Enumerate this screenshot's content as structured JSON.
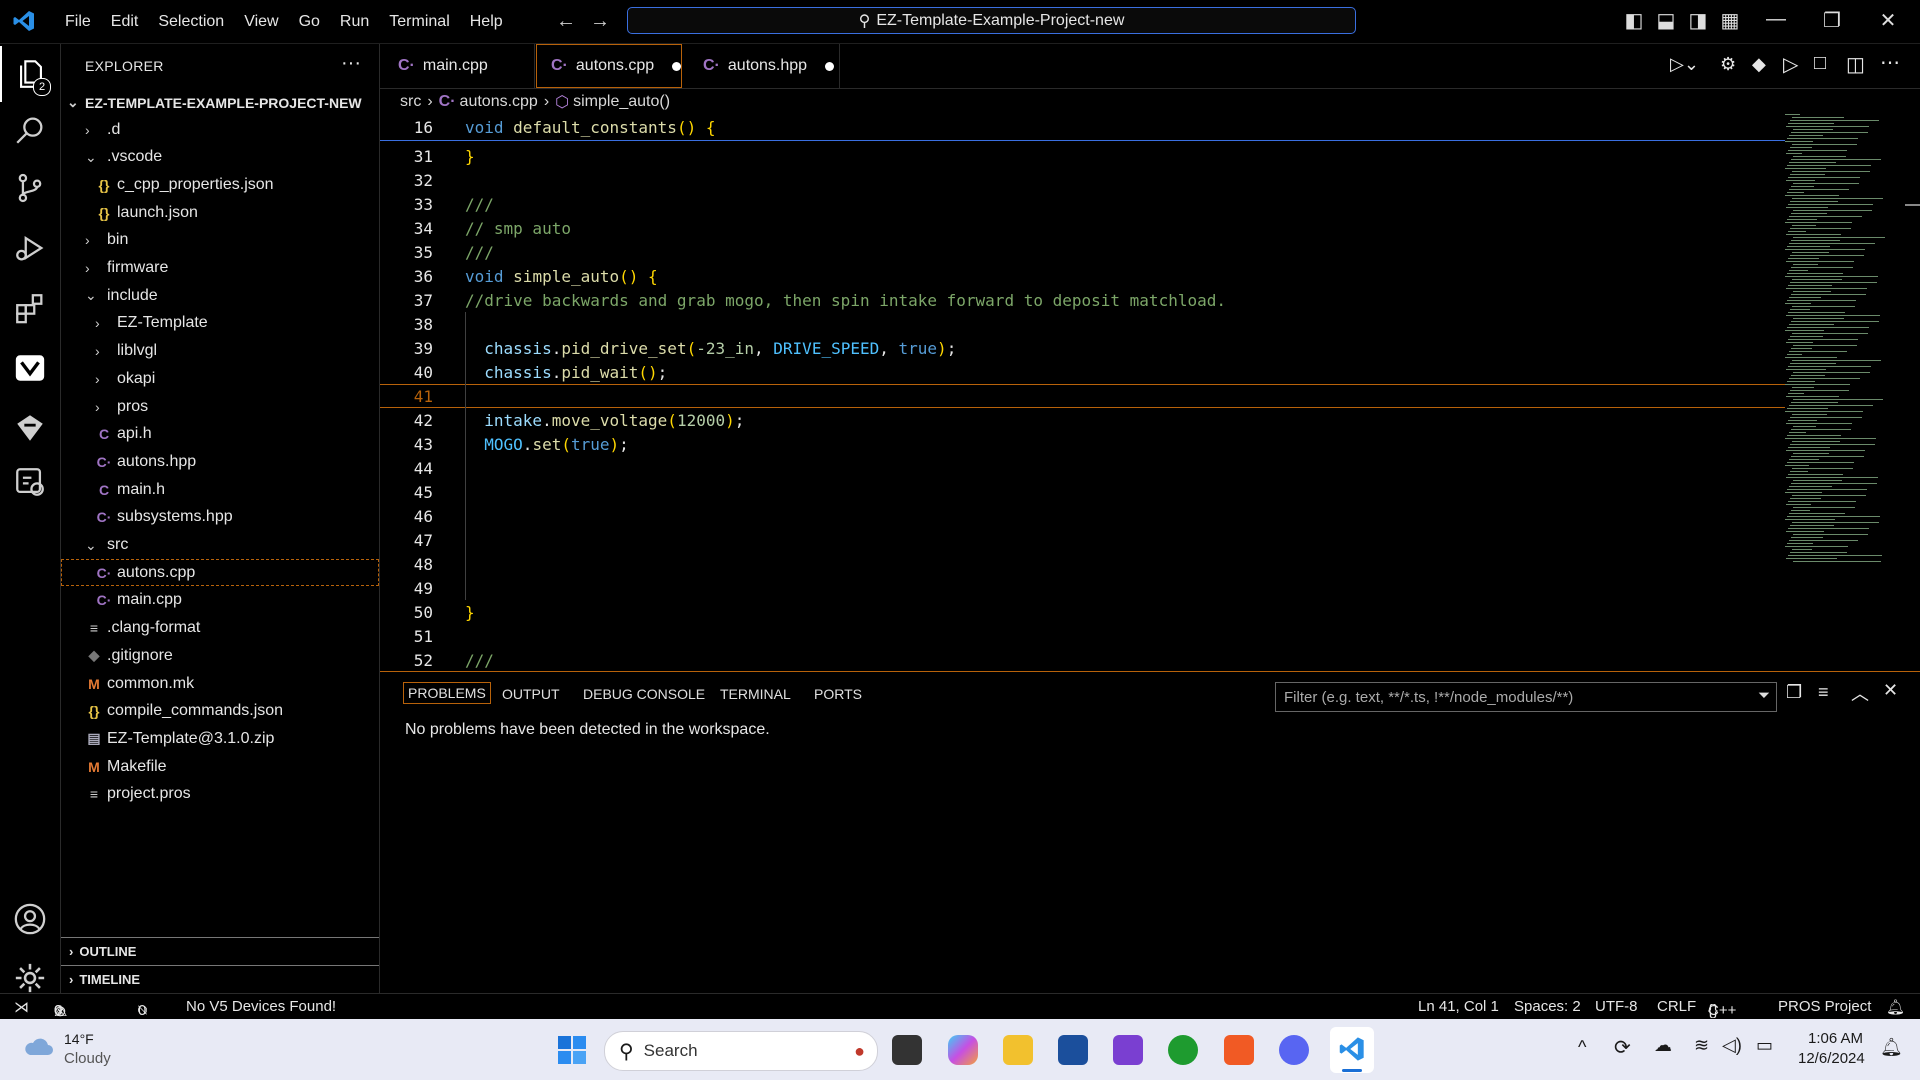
{
  "titlebar": {
    "menu": [
      "File",
      "Edit",
      "Selection",
      "View",
      "Go",
      "Run",
      "Terminal",
      "Help"
    ],
    "command_center": "EZ-Template-Example-Project-new"
  },
  "activity": {
    "explorer_badge": "2"
  },
  "sidebar": {
    "header": "EXPLORER",
    "more": "···",
    "root": "EZ-TEMPLATE-EXAMPLE-PROJECT-NEW",
    "items": [
      {
        "label": ".d"
      },
      {
        "label": ".vscode"
      },
      {
        "label": "c_cpp_properties.json"
      },
      {
        "label": "launch.json"
      },
      {
        "label": "bin"
      },
      {
        "label": "firmware"
      },
      {
        "label": "include"
      },
      {
        "label": "EZ-Template"
      },
      {
        "label": "liblvgl"
      },
      {
        "label": "okapi"
      },
      {
        "label": "pros"
      },
      {
        "label": "api.h"
      },
      {
        "label": "autons.hpp"
      },
      {
        "label": "main.h"
      },
      {
        "label": "subsystems.hpp"
      },
      {
        "label": "src"
      },
      {
        "label": "autons.cpp"
      },
      {
        "label": "main.cpp"
      },
      {
        "label": ".clang-format"
      },
      {
        "label": ".gitignore"
      },
      {
        "label": "common.mk"
      },
      {
        "label": "compile_commands.json"
      },
      {
        "label": "EZ-Template@3.1.0.zip"
      },
      {
        "label": "Makefile"
      },
      {
        "label": "project.pros"
      }
    ],
    "outline": "OUTLINE",
    "timeline": "TIMELINE"
  },
  "tabs": [
    {
      "label": "main.cpp"
    },
    {
      "label": "autons.cpp"
    },
    {
      "label": "autons.hpp"
    }
  ],
  "breadcrumb": {
    "part1": "src",
    "part2": "autons.cpp",
    "part3": "simple_auto()"
  },
  "code": {
    "sticky_ln": "16",
    "lines": [
      {
        "ln": "31"
      },
      {
        "ln": "32"
      },
      {
        "ln": "33"
      },
      {
        "ln": "34"
      },
      {
        "ln": "35"
      },
      {
        "ln": "36"
      },
      {
        "ln": "37"
      },
      {
        "ln": "38"
      },
      {
        "ln": "39"
      },
      {
        "ln": "40"
      },
      {
        "ln": "41"
      },
      {
        "ln": "42"
      },
      {
        "ln": "43"
      },
      {
        "ln": "44"
      },
      {
        "ln": "45"
      },
      {
        "ln": "46"
      },
      {
        "ln": "47"
      },
      {
        "ln": "48"
      },
      {
        "ln": "49"
      },
      {
        "ln": "50"
      },
      {
        "ln": "51"
      },
      {
        "ln": "52"
      }
    ],
    "t": {
      "void": "void",
      "default_constants": "default_constants",
      "paren": "()",
      "brace_open": " {",
      "brace_close": "}",
      "triple": "///",
      "smp": "// smp auto",
      "simple_auto": "simple_auto",
      "comment37": "//drive backwards and grab mogo, then spin intake forward to deposit matchload.",
      "chassis": "chassis",
      "dot": ".",
      "pid_drive_set": "pid_drive_set",
      "lp": "(",
      "rp": ")",
      "semi": ";",
      "neg23": "-23_in",
      "comma_sp": ", ",
      "drive_speed": "DRIVE_SPEED",
      "true": "true",
      "pid_wait": "pid_wait",
      "intake": "intake",
      "move_voltage": "move_voltage",
      "v12000": "12000",
      "mogo": "MOGO",
      "set": "set"
    }
  },
  "panel": {
    "tabs": [
      "PROBLEMS",
      "OUTPUT",
      "DEBUG CONSOLE",
      "TERMINAL",
      "PORTS"
    ],
    "filter_placeholder": "Filter (e.g. text, **/*.ts, !**/node_modules/**)",
    "message": "No problems have been detected in the workspace."
  },
  "status": {
    "errors": "0",
    "warnings": "0",
    "ports": "0",
    "devices": "No V5 Devices Found!",
    "position": "Ln 41, Col 1",
    "spaces": "Spaces: 2",
    "encoding": "UTF-8",
    "eol": "CRLF",
    "language": "C++",
    "project": "PROS Project"
  },
  "taskbar": {
    "temp": "14°F",
    "weather": "Cloudy",
    "search": "Search",
    "time": "1:06 AM",
    "date": "12/6/2024"
  },
  "colors": {
    "accent": "#b8620a",
    "keyword": "#569cd6",
    "function": "#dcdcaa",
    "comment": "#7ca668",
    "bracket": "#ffd700"
  }
}
